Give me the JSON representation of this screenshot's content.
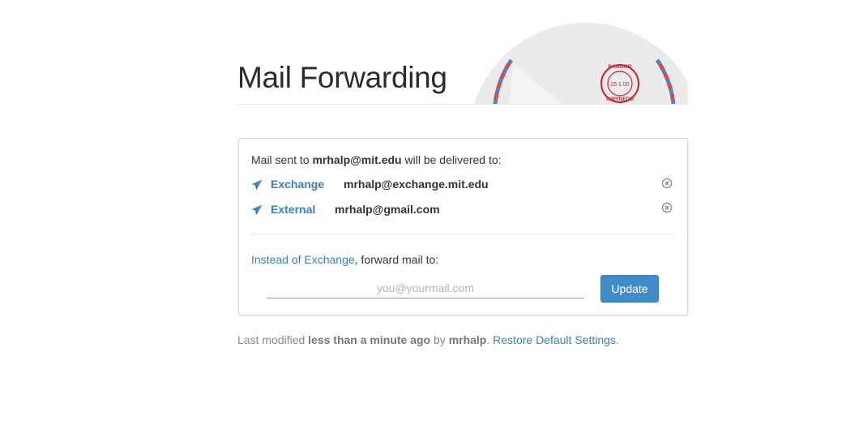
{
  "page": {
    "title": "Mail Forwarding"
  },
  "stamp": {
    "top_text": "BANGOR",
    "date_text": "25 1 00",
    "bottom_text": "GWYNEDD"
  },
  "card": {
    "intro_prefix": "Mail sent to ",
    "intro_email": "mrhalp@mit.edu",
    "intro_suffix": " will be delivered to:",
    "destinations": [
      {
        "type": "Exchange",
        "address": "mrhalp@exchange.mit.edu",
        "icon": "paper-plane-icon",
        "remove_icon": "remove-circle-icon"
      },
      {
        "type": "External",
        "address": "mrhalp@gmail.com",
        "icon": "paper-plane-icon",
        "remove_icon": "remove-circle-icon"
      }
    ],
    "forward_link": "Instead of Exchange",
    "forward_suffix": ", forward mail to:",
    "input_placeholder": "you@yourmail.com",
    "input_value": "",
    "update_label": "Update"
  },
  "footer": {
    "prefix": "Last modified ",
    "time": "less than a minute ago",
    "by": " by ",
    "user": "mrhalp",
    "period": ". ",
    "restore_link": "Restore Default Settings",
    "end": "."
  },
  "colors": {
    "link": "#3a7fc1",
    "button": "#428bca",
    "stamp_red": "#c8262f",
    "airmail_red": "#e1444b",
    "airmail_blue": "#4d85c2"
  }
}
